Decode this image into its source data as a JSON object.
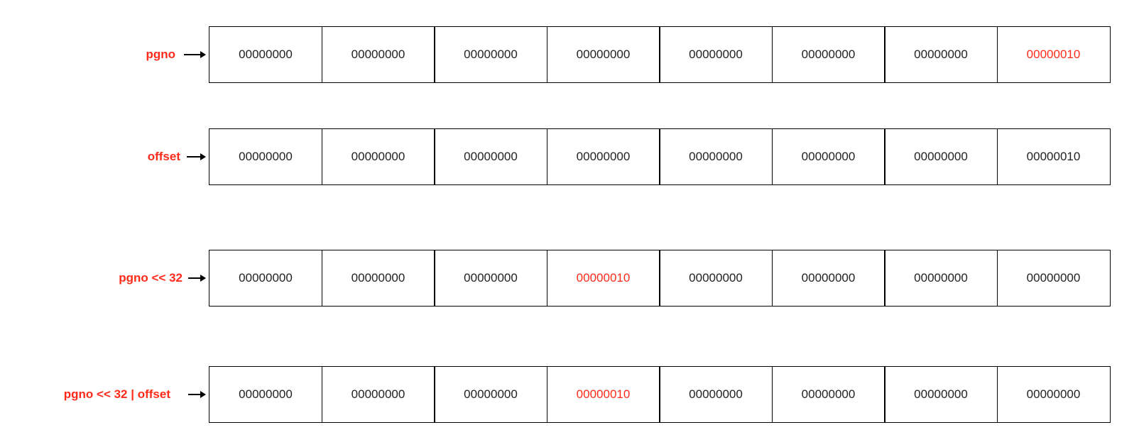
{
  "colors": {
    "accent": "#ff2a1a",
    "text": "#222222",
    "border": "#000000",
    "background": "#ffffff"
  },
  "rows": [
    {
      "label": "pgno",
      "cells": [
        {
          "value": "00000000",
          "highlight": false
        },
        {
          "value": "00000000",
          "highlight": false
        },
        {
          "value": "00000000",
          "highlight": false
        },
        {
          "value": "00000000",
          "highlight": false
        },
        {
          "value": "00000000",
          "highlight": false
        },
        {
          "value": "00000000",
          "highlight": false
        },
        {
          "value": "00000000",
          "highlight": false
        },
        {
          "value": "00000010",
          "highlight": true
        }
      ]
    },
    {
      "label": "offset",
      "cells": [
        {
          "value": "00000000",
          "highlight": false
        },
        {
          "value": "00000000",
          "highlight": false
        },
        {
          "value": "00000000",
          "highlight": false
        },
        {
          "value": "00000000",
          "highlight": false
        },
        {
          "value": "00000000",
          "highlight": false
        },
        {
          "value": "00000000",
          "highlight": false
        },
        {
          "value": "00000000",
          "highlight": false
        },
        {
          "value": "00000010",
          "highlight": false
        }
      ]
    },
    {
      "label": "pgno << 32",
      "cells": [
        {
          "value": "00000000",
          "highlight": false
        },
        {
          "value": "00000000",
          "highlight": false
        },
        {
          "value": "00000000",
          "highlight": false
        },
        {
          "value": "00000010",
          "highlight": true
        },
        {
          "value": "00000000",
          "highlight": false
        },
        {
          "value": "00000000",
          "highlight": false
        },
        {
          "value": "00000000",
          "highlight": false
        },
        {
          "value": "00000000",
          "highlight": false
        }
      ]
    },
    {
      "label": "pgno << 32 | offset",
      "cells": [
        {
          "value": "00000000",
          "highlight": false
        },
        {
          "value": "00000000",
          "highlight": false
        },
        {
          "value": "00000000",
          "highlight": false
        },
        {
          "value": "00000010",
          "highlight": true
        },
        {
          "value": "00000000",
          "highlight": false
        },
        {
          "value": "00000000",
          "highlight": false
        },
        {
          "value": "00000000",
          "highlight": false
        },
        {
          "value": "00000000",
          "highlight": false
        }
      ]
    }
  ]
}
